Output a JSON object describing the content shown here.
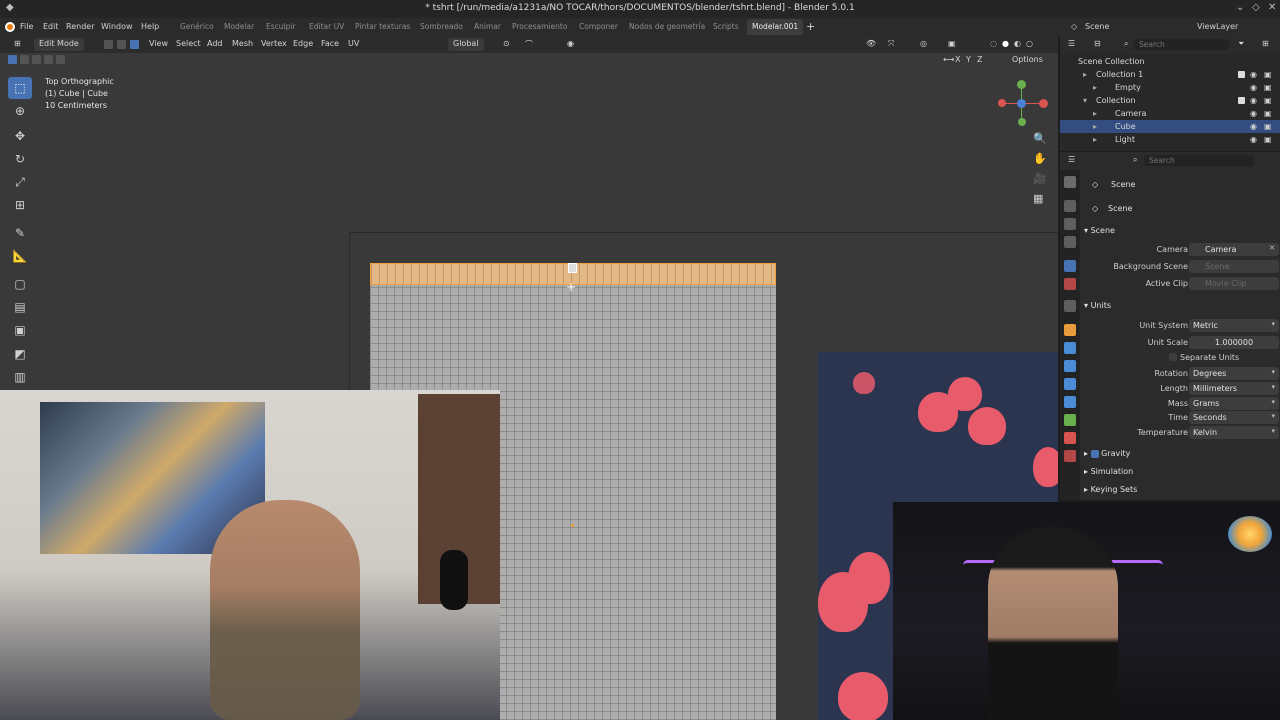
{
  "window": {
    "title": "* tshrt [/run/media/a1231a/NO TOCAR/thors/DOCUMENTOS/blender/tshrt.blend] - Blender 5.0.1"
  },
  "menus": [
    "File",
    "Edit",
    "Render",
    "Window",
    "Help"
  ],
  "workspaces": [
    "Genérico",
    "Modelar",
    "Esculpir",
    "Editar UV",
    "Pintar texturas",
    "Sombreado",
    "Animar",
    "Procesamiento",
    "Componer",
    "Nodos de geometría",
    "Scripts",
    "Modelar.001"
  ],
  "active_workspace": "Modelar.001",
  "scene_selector": {
    "label": "Scene"
  },
  "viewlayer_selector": {
    "label": "ViewLayer"
  },
  "viewport_header": {
    "mode": "Edit Mode",
    "menus": [
      "View",
      "Select",
      "Add",
      "Mesh",
      "Vertex",
      "Edge",
      "Face",
      "UV"
    ],
    "orientation": "Global",
    "options_label": "Options",
    "axis_toggles": [
      "X",
      "Y",
      "Z"
    ]
  },
  "viewport_overlay": {
    "line1": "Top Orthographic",
    "line2": "(1) Cube | Cube",
    "line3": "10 Centimeters"
  },
  "outliner": {
    "search_placeholder": "Search",
    "root": "Scene Collection",
    "rows": [
      {
        "label": "Collection 1"
      },
      {
        "label": "Empty"
      },
      {
        "label": "Collection"
      },
      {
        "label": "Camera"
      },
      {
        "label": "Cube"
      },
      {
        "label": "Light"
      }
    ],
    "selected": "Cube"
  },
  "properties": {
    "search_placeholder": "Search",
    "context_label": "Scene",
    "breadcrumb": "Scene",
    "scene_panel": {
      "title": "Scene",
      "camera_label": "Camera",
      "camera_value": "Camera",
      "background_label": "Background Scene",
      "background_placeholder": "Scene",
      "clip_label": "Active Clip",
      "clip_placeholder": "Movie Clip"
    },
    "units_panel": {
      "title": "Units",
      "unit_system_label": "Unit System",
      "unit_system_value": "Metric",
      "unit_scale_label": "Unit Scale",
      "unit_scale_value": "1.000000",
      "separate_units_label": "Separate Units",
      "rotation_label": "Rotation",
      "rotation_value": "Degrees",
      "length_label": "Length",
      "length_value": "Millimeters",
      "mass_label": "Mass",
      "mass_value": "Grams",
      "time_label": "Time",
      "time_value": "Seconds",
      "temperature_label": "Temperature",
      "temperature_value": "Kelvin"
    },
    "collapsed_panels": {
      "gravity": "Gravity",
      "simulation": "Simulation",
      "keying_sets": "Keying Sets"
    }
  },
  "colors": {
    "accent": "#4772b3",
    "selected_face": "#e1b886",
    "mesh": "#adadad"
  }
}
